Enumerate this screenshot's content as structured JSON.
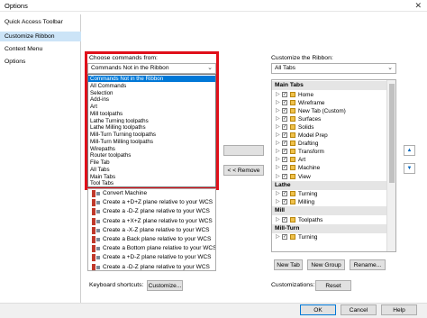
{
  "window": {
    "title": "Options",
    "close_icon": "✕"
  },
  "sidebar": {
    "items": [
      {
        "label": "Quick Access Toolbar",
        "selected": false
      },
      {
        "label": "Customize Ribbon",
        "selected": true
      },
      {
        "label": "Context Menu",
        "selected": false
      },
      {
        "label": "Options",
        "selected": false
      }
    ]
  },
  "left": {
    "choose_label": "Choose commands from:",
    "combo_value": "Commands Not in the Ribbon",
    "dropdown_options": [
      "Commands Not in the Ribbon",
      "All Commands",
      "Selection",
      "Add-ins",
      "Art",
      "Mill toolpaths",
      "Lathe Turning toolpaths",
      "Lathe Milling toolpaths",
      "Mill-Turn Turning toolpaths",
      "Mill-Turn Milling toolpaths",
      "Wirepaths",
      "Router toolpaths",
      "File Tab",
      "All Tabs",
      "Main Tabs",
      "Tool Tabs"
    ],
    "commands": [
      "Convert Machine",
      "Create a +D+Z plane relative to your WCS",
      "Create a -D-Z plane relative to your WCS",
      "Create a +X+Z plane relative to your WCS",
      "Create a -X-Z plane relative to your WCS",
      "Create a Back plane relative to your WCS",
      "Create a Bottom plane relative to your WCS",
      "Create a +D-Z plane relative to your WCS",
      "Create a -D-Z plane relative to your WCS"
    ],
    "keyboard_label": "Keyboard shortcuts:",
    "customize_button": "Customize..."
  },
  "middle": {
    "add_button": "",
    "remove_button": "< < Remove"
  },
  "right": {
    "customize_label": "Customize the Ribbon:",
    "combo_value": "All Tabs",
    "tree": [
      {
        "kind": "head",
        "label": "Main Tabs"
      },
      {
        "kind": "item",
        "label": "Home"
      },
      {
        "kind": "item",
        "label": "Wireframe"
      },
      {
        "kind": "item",
        "label": "New Tab (Custom)"
      },
      {
        "kind": "item",
        "label": "Surfaces"
      },
      {
        "kind": "item",
        "label": "Solids"
      },
      {
        "kind": "item",
        "label": "Model Prep"
      },
      {
        "kind": "item",
        "label": "Drafting"
      },
      {
        "kind": "item",
        "label": "Transform"
      },
      {
        "kind": "item",
        "label": "Art"
      },
      {
        "kind": "item",
        "label": "Machine"
      },
      {
        "kind": "item",
        "label": "View"
      },
      {
        "kind": "head",
        "label": "Lathe"
      },
      {
        "kind": "item",
        "label": "Turning"
      },
      {
        "kind": "item",
        "label": "Milling"
      },
      {
        "kind": "head",
        "label": "Mill"
      },
      {
        "kind": "item",
        "label": "Toolpaths"
      },
      {
        "kind": "head",
        "label": "Mill-Turn"
      },
      {
        "kind": "item",
        "label": "Turning"
      }
    ],
    "new_tab_button": "New Tab",
    "new_group_button": "New Group",
    "rename_button": "Rename...",
    "customizations_label": "Customizations:",
    "reset_button": "Reset",
    "up_icon": "▲",
    "down_icon": "▼"
  },
  "footer": {
    "ok_button": "OK",
    "cancel_button": "Cancel",
    "help_button": "Help"
  }
}
